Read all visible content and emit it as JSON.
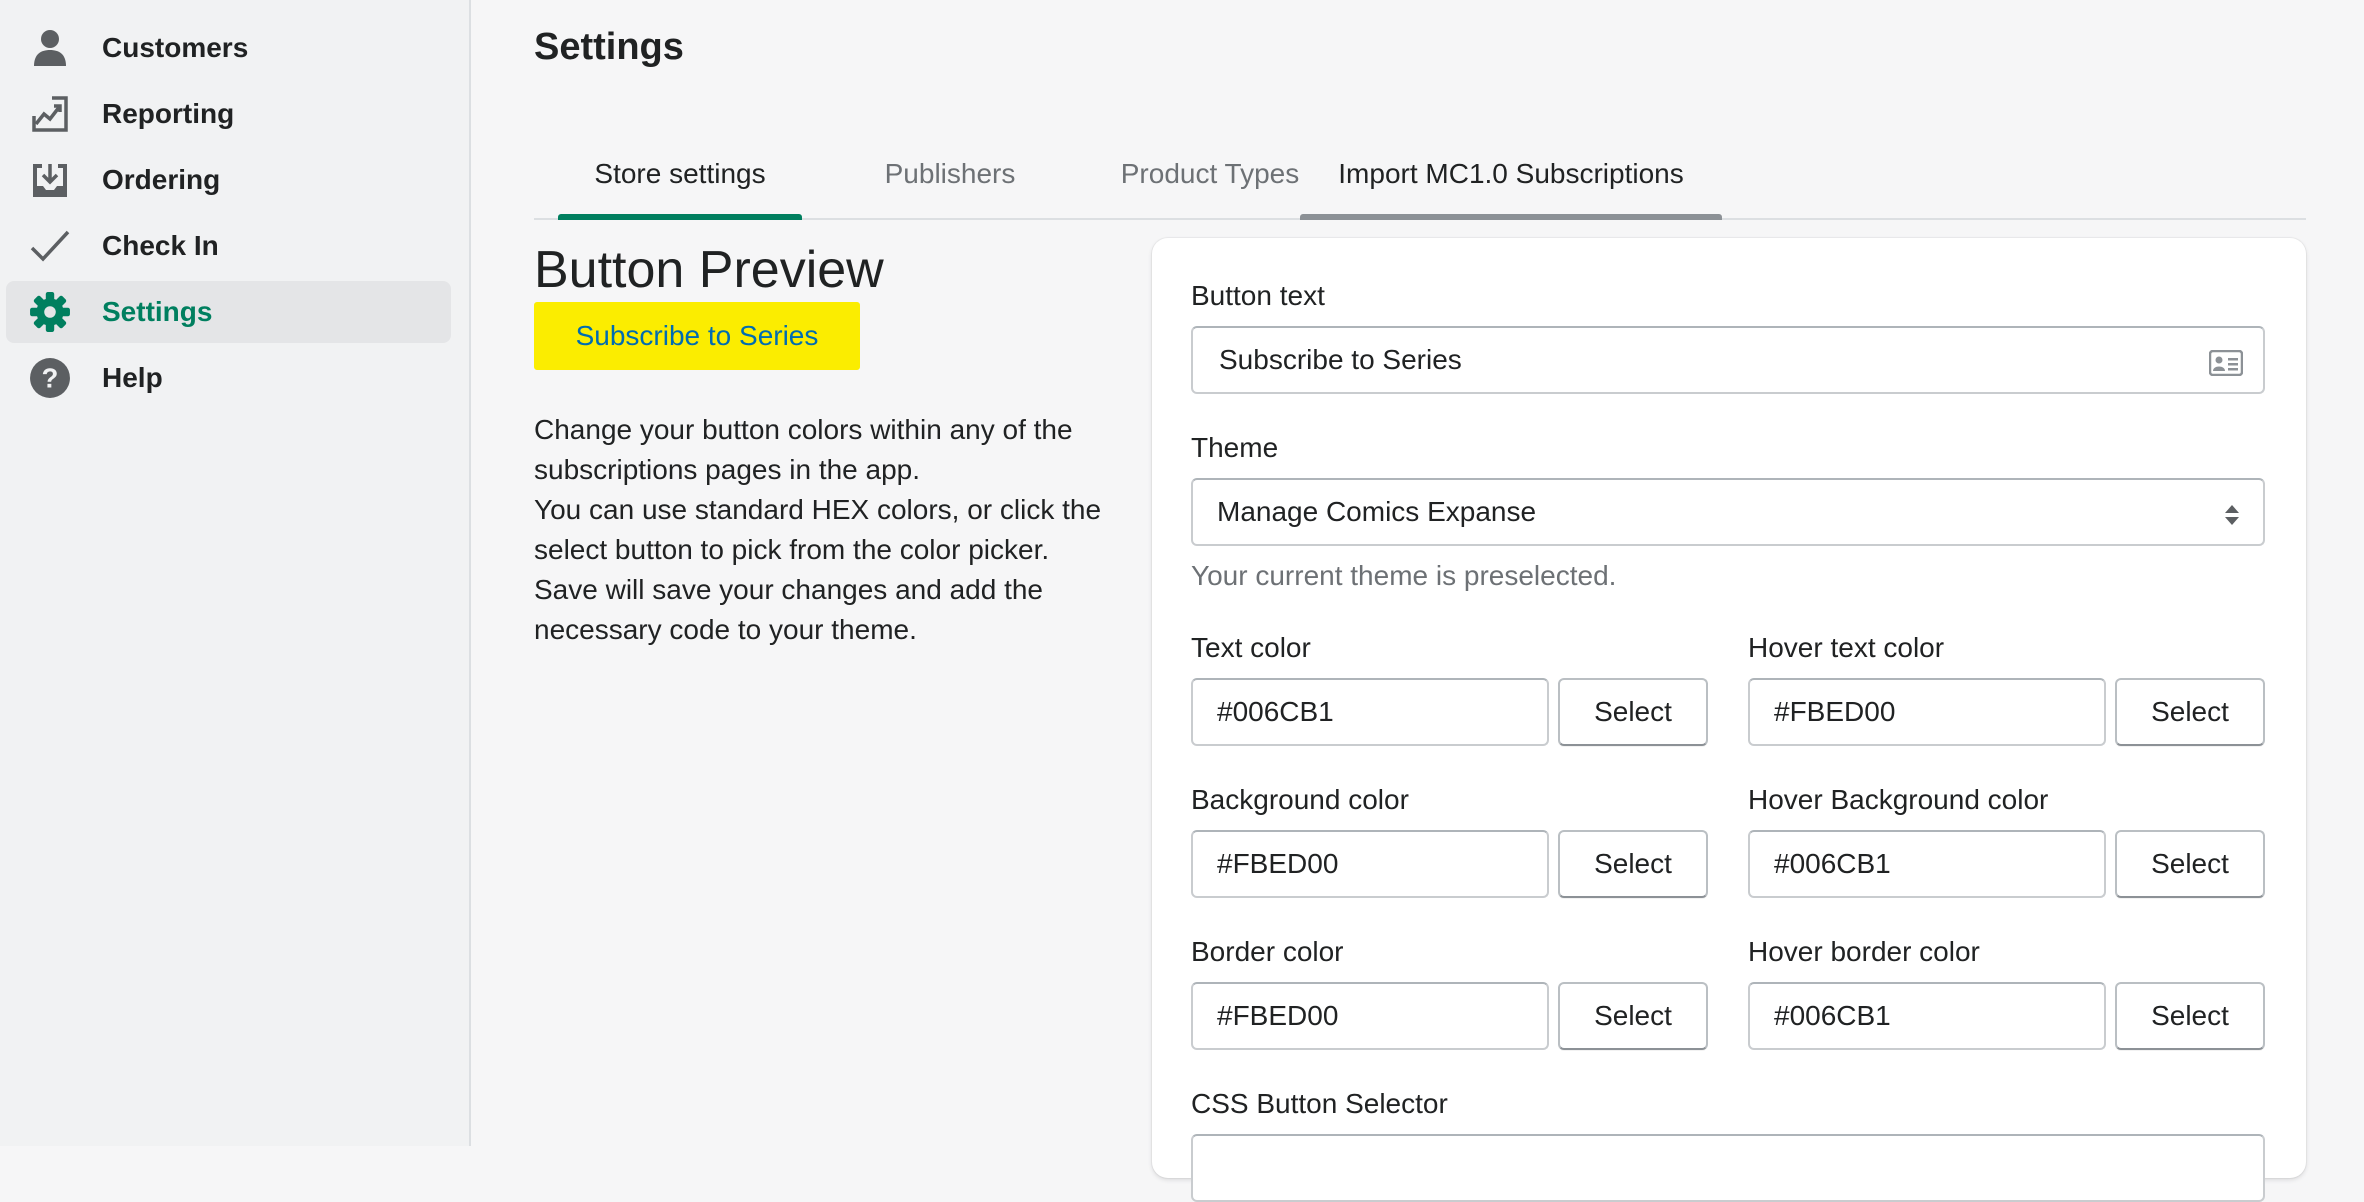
{
  "sidebar": {
    "items": [
      {
        "label": "Customers",
        "icon": "person-icon"
      },
      {
        "label": "Reporting",
        "icon": "chart-icon"
      },
      {
        "label": "Ordering",
        "icon": "download-icon"
      },
      {
        "label": "Check In",
        "icon": "checkmark-icon"
      },
      {
        "label": "Settings",
        "icon": "gear-icon",
        "active": true
      },
      {
        "label": "Help",
        "icon": "question-icon"
      }
    ]
  },
  "page": {
    "title": "Settings"
  },
  "tabs": [
    {
      "label": "Store settings",
      "active": true
    },
    {
      "label": "Publishers"
    },
    {
      "label": "Product Types"
    },
    {
      "label": "Import MC1.0 Subscriptions",
      "hovered": true
    }
  ],
  "preview": {
    "title": "Button Preview",
    "button_label": "Subscribe to Series",
    "help_lines": [
      "Change your button colors within any of the subscriptions pages in the app.",
      "You can use standard HEX colors, or click the select button to pick from the color picker.",
      "Save will save your changes and add the necessary code to your theme."
    ]
  },
  "form": {
    "button_text": {
      "label": "Button text",
      "value": "Subscribe to Series"
    },
    "theme": {
      "label": "Theme",
      "value": "Manage Comics Expanse",
      "hint": "Your current theme is preselected."
    },
    "select_label": "Select",
    "text_color": {
      "label": "Text color",
      "value": "#006CB1"
    },
    "hover_text_color": {
      "label": "Hover text color",
      "value": "#FBED00"
    },
    "background_color": {
      "label": "Background color",
      "value": "#FBED00"
    },
    "hover_background_color": {
      "label": "Hover Background color",
      "value": "#006CB1"
    },
    "border_color": {
      "label": "Border color",
      "value": "#FBED00"
    },
    "hover_border_color": {
      "label": "Hover border color",
      "value": "#006CB1"
    },
    "css_selector": {
      "label": "CSS Button Selector"
    }
  },
  "colors": {
    "accent": "#007f5f",
    "preview_bg": "#FBED00",
    "preview_text": "#006CB1"
  }
}
